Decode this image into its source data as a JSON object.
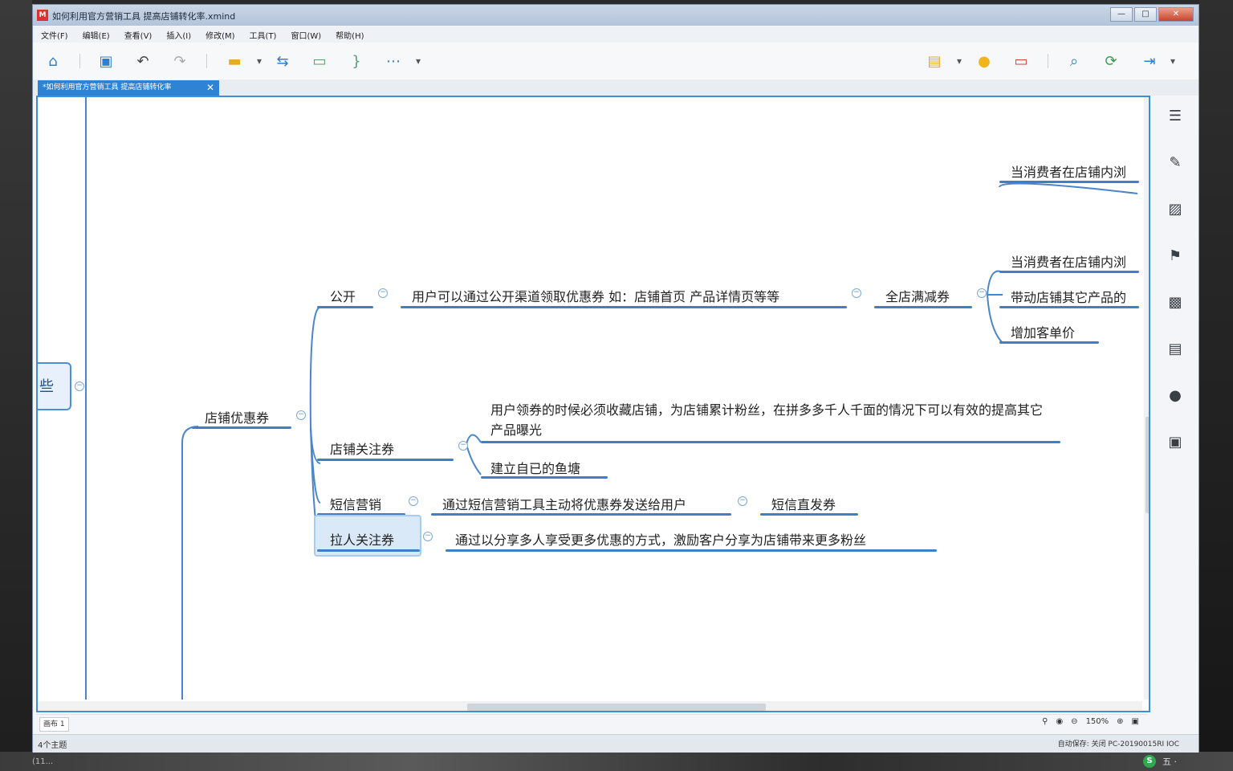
{
  "window": {
    "title": "如何利用官方营销工具 提高店铺转化率.xmind",
    "app_logo": "M",
    "buttons": [
      "—",
      "□",
      "✕"
    ]
  },
  "menu": [
    "文件(F)",
    "编辑(E)",
    "查看(V)",
    "插入(I)",
    "修改(M)",
    "工具(T)",
    "窗口(W)",
    "帮助(H)"
  ],
  "toolbar": {
    "icons": [
      "home-icon",
      "save-icon",
      "undo-icon",
      "redo-icon",
      "topic-icon",
      "relationship-icon",
      "boundary-icon",
      "summary-icon",
      "more-icon",
      "presentation-icon",
      "idea-icon",
      "outline-icon",
      "zoom-icon",
      "share-icon",
      "export-icon"
    ]
  },
  "tab": {
    "label": "*如何利用官方营销工具 提高店铺转化率",
    "close": "✕"
  },
  "mindmap": {
    "root_partial": "些",
    "main": "店铺优惠券",
    "branches": {
      "public": "公开",
      "public_desc": "用户可以通过公开渠道领取优惠券 如：店铺首页 产品详情页等等",
      "storewide": "全店满减券",
      "consumer_1": "当消费者在店铺内浏",
      "consumer_2": "当消费者在店铺内浏",
      "drive": "带动店铺其它产品的",
      "price": "增加客单价",
      "follow": "店铺关注券",
      "follow_desc": "用户领券的时候必须收藏店铺，为店铺累计粉丝，在拼多多千人千面的情况下可以有效的提高其它产品曝光",
      "pool": "建立自已的鱼塘",
      "sms": "短信营销",
      "sms_desc": "通过短信营销工具主动将优惠券发送给用户",
      "sms_direct": "短信直发券",
      "invite": "拉人关注券",
      "invite_desc": "通过以分享多人享受更多优惠的方式，激励客户分享为店铺带来更多粉丝"
    }
  },
  "footer": {
    "sheet": "画布 1",
    "zoom": "150%"
  },
  "status": {
    "left": "4个主题",
    "right": "自动保存: 关闭   PC-20190015RI IOC"
  },
  "taskbar": {
    "tray_text": "五 ·",
    "bl": "(11..."
  }
}
